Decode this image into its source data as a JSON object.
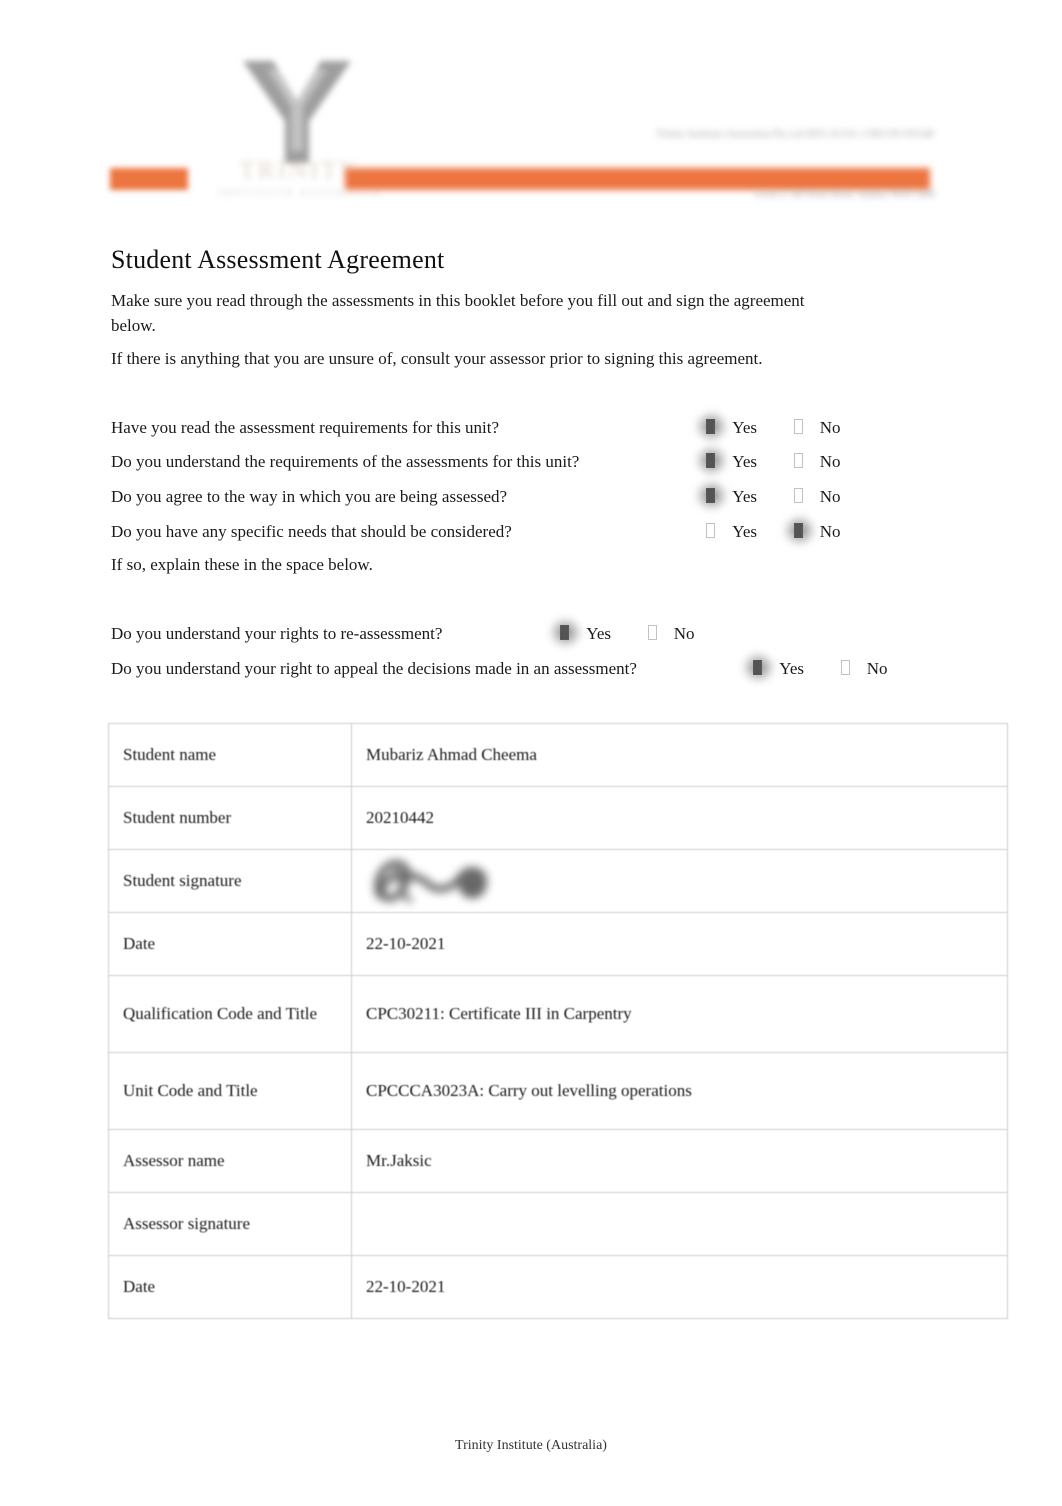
{
  "document": {
    "title": "Student Assessment Agreement",
    "intro_paragraph_1": "Make sure you read through the assessments in this booklet before you fill out and sign the agreement below.",
    "intro_paragraph_2": "If there is anything that you are unsure of, consult your assessor prior to signing this agreement.",
    "if_so_note": "If so, explain these in the space below.",
    "footer_text": "Trinity Institute (Australia)"
  },
  "letterhead": {
    "logo_wordmark": "TRINITY",
    "logo_subwordmark": "INSTITUTE AUSTRALIA",
    "contact_block_upper": "Trinity Institute (Australia) Pty Ltd\nRTO 41310 | CRICOS 03534F",
    "contact_block_lower": "Level 2, 545 Kent Street, Sydney NSW 2000",
    "accent_color": "#ec7540"
  },
  "options": {
    "yes_label": "Yes",
    "no_label": "No"
  },
  "questions": [
    {
      "text": "Have you read the assessment requirements for this unit?",
      "answer": "Yes"
    },
    {
      "text": "Do you understand the requirements of the assessments for this unit?",
      "answer": "Yes"
    },
    {
      "text": "Do you agree to the way in which you are being assessed?",
      "answer": "Yes"
    },
    {
      "text": "Do you have any specific needs that should be considered?",
      "answer": "No"
    },
    {
      "text": "Do you understand your rights to re-assessment?",
      "answer": "Yes"
    },
    {
      "text": "Do you understand your right to appeal the decisions made in an assessment?",
      "answer": "Yes"
    }
  ],
  "details_table": {
    "rows": [
      {
        "label": "Student name",
        "value": "Mubariz Ahmad Cheema"
      },
      {
        "label": "Student number",
        "value": "20210442"
      },
      {
        "label": "Student signature",
        "value": ""
      },
      {
        "label": "Date",
        "value": "22-10-2021"
      },
      {
        "label": "Qualification Code and Title",
        "value": "CPC30211: Certificate III in Carpentry"
      },
      {
        "label": "Unit Code and Title",
        "value": "CPCCCA3023A: Carry out levelling operations"
      },
      {
        "label": "Assessor name",
        "value": "Mr.Jaksic"
      },
      {
        "label": "Assessor signature",
        "value": ""
      },
      {
        "label": "Date",
        "value": "22-10-2021"
      }
    ]
  }
}
